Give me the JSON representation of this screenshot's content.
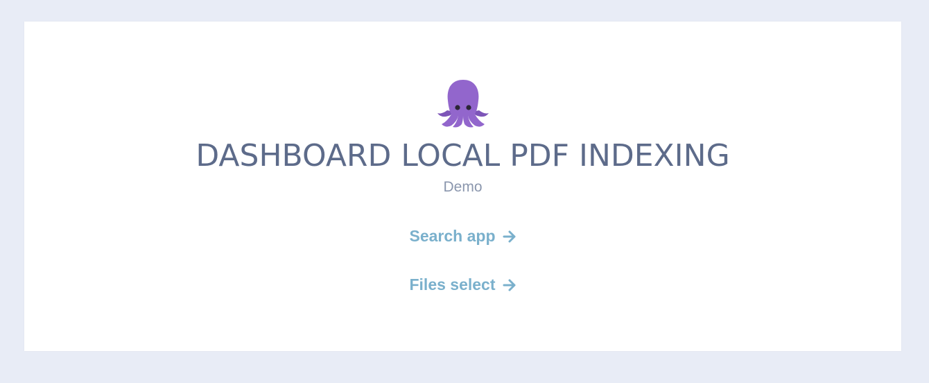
{
  "header": {
    "logo_icon": "octopus-icon",
    "title": "DASHBOARD LOCAL PDF INDEXING",
    "subtitle": "Demo"
  },
  "links": [
    {
      "label": "Search app",
      "icon": "arrow-right-icon"
    },
    {
      "label": "Files select",
      "icon": "arrow-right-icon"
    }
  ],
  "colors": {
    "page_background": "#e8ecf6",
    "card_background": "#ffffff",
    "title": "#5d6b8a",
    "subtitle": "#8a96ad",
    "link": "#7ab0cc",
    "logo": "#9266cc"
  }
}
